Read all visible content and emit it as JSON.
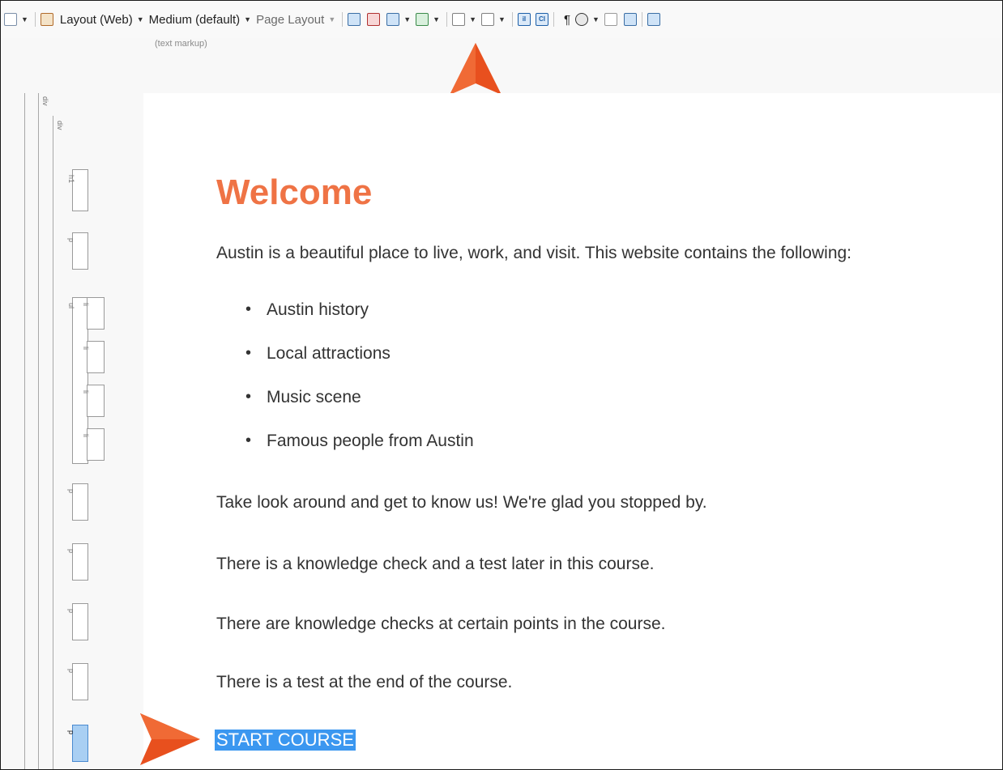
{
  "toolbar": {
    "layout_label": "Layout (Web)",
    "medium_label": "Medium (default)",
    "page_layout_label": "Page Layout",
    "text_markup_caption": "(text markup)",
    "show_tags_label": "¶",
    "ci_label": "CI",
    "il_label": "iI"
  },
  "structure_bar": {
    "tags": [
      "div",
      "div",
      "h1",
      "p",
      "ul",
      "li",
      "li",
      "li",
      "li",
      "p",
      "p",
      "p",
      "p",
      "p"
    ]
  },
  "content": {
    "heading": "Welcome",
    "intro": "Austin is a beautiful place to live, work, and visit. This website contains the following:",
    "bullets": [
      "Austin history",
      "Local attractions",
      "Music scene",
      "Famous people from Austin"
    ],
    "p1": "Take look around and get to know us! We're glad you stopped by.",
    "p2": "There is a knowledge check and a test later in this course.",
    "p3": "There are knowledge checks at certain points in the course.",
    "p4": "There is a test at the end of the course.",
    "start_link": "START COURSE"
  },
  "colors": {
    "heading": "#ef7345",
    "selection": "#3b97f0",
    "callout_arrow": "#e8501e"
  }
}
